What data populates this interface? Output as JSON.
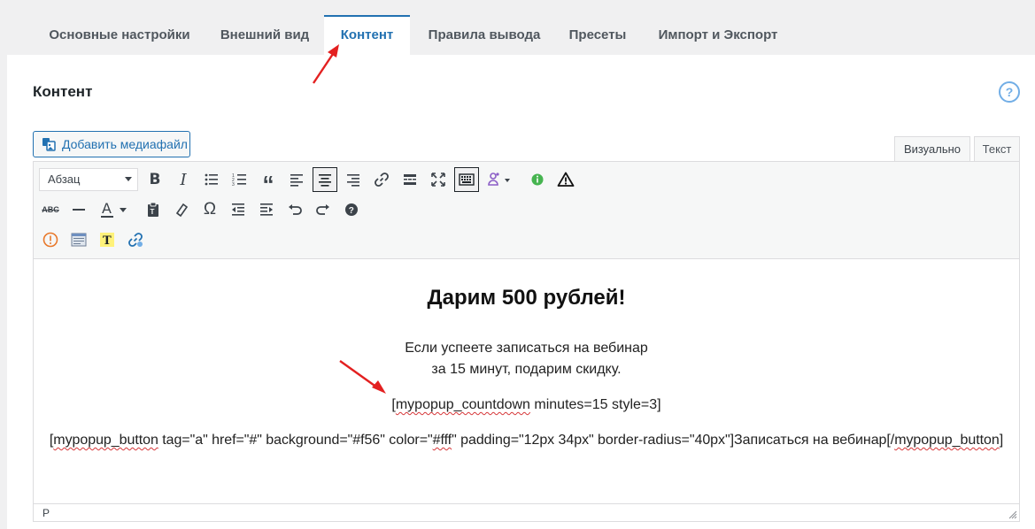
{
  "tabs": [
    {
      "label": "Основные настройки"
    },
    {
      "label": "Внешний вид"
    },
    {
      "label": "Контент"
    },
    {
      "label": "Правила вывода"
    },
    {
      "label": "Пресеты"
    },
    {
      "label": "Импорт и Экспорт"
    }
  ],
  "active_tab": "Контент",
  "page_title": "Контент",
  "help_glyph": "?",
  "media_button": "Добавить медиафайл",
  "editor_modes": {
    "visual": "Визуально",
    "text": "Текст"
  },
  "format_select": "Абзац",
  "toolbar_row1": [
    "bold-icon",
    "italic-icon",
    "bullet-list-icon",
    "numbered-list-icon",
    "blockquote-icon",
    "align-left-icon",
    "align-center-icon",
    "align-right-icon",
    "link-icon",
    "read-more-icon",
    "fullscreen-icon",
    "toolbar-toggle-icon",
    "user-dropdown-icon",
    "info-green-icon",
    "warning-icon"
  ],
  "toolbar_row2": [
    "strikethrough-icon",
    "horizontal-line-icon",
    "text-color-icon",
    "paste-text-icon",
    "clear-format-icon",
    "special-char-icon",
    "outdent-icon",
    "indent-icon",
    "undo-icon",
    "redo-icon",
    "help-icon"
  ],
  "toolbar_row3": [
    "alert-orange-icon",
    "window-icon",
    "text-highlight-icon",
    "shortlink-icon"
  ],
  "content": {
    "heading": "Дарим 500 рублей!",
    "line1": "Если успеете записаться на вебинар",
    "line2": "за 15 минут, подарим скидку.",
    "countdown_open": "[",
    "countdown_tag": "mypopup_countdown",
    "countdown_rest": " minutes=15 style=3]",
    "button_open": "[",
    "button_tag": "mypopup_button",
    "button_mid1": " tag=\"a\" href=\"#\" background=\"#f56\" color=\"",
    "button_fff": "#fff",
    "button_mid2": "\" padding=\"12px 34px\" border-radius=\"40px\"]Записаться на вебинар[/",
    "button_close_tag": "mypopup_button",
    "button_end": "]"
  },
  "status_path": "P",
  "colors": {
    "accent": "#2271b1",
    "arrow": "#e32020",
    "spellcheck": "#d63638"
  }
}
